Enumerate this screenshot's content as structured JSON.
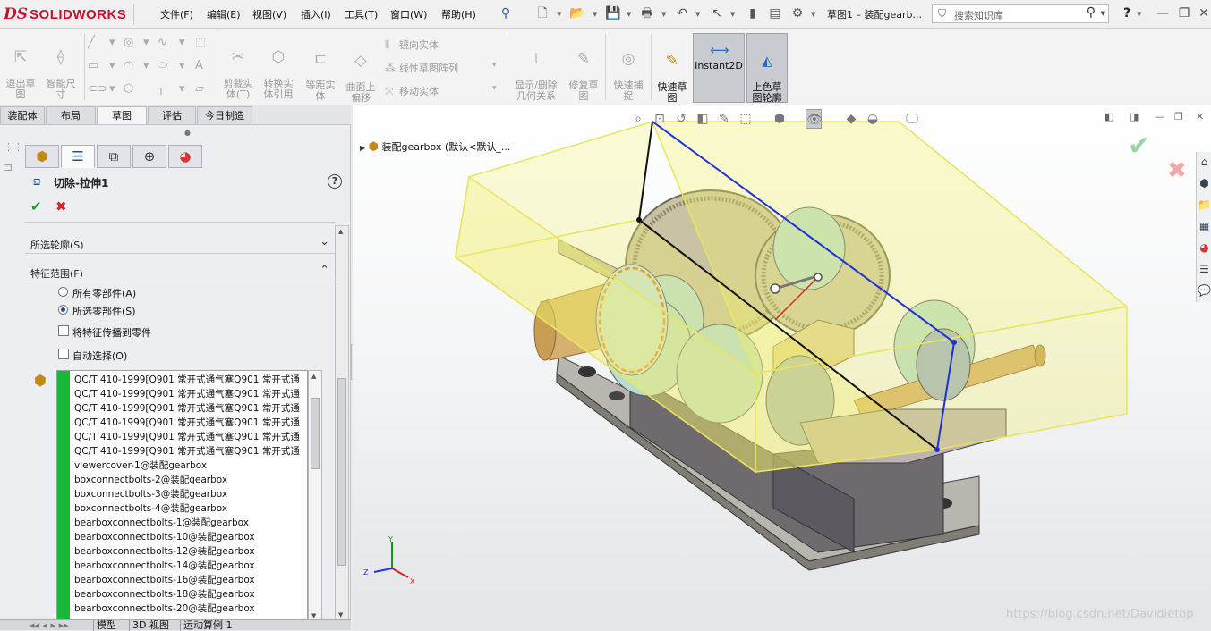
{
  "app": {
    "logo_ds": "DS",
    "logo_text": "SOLIDWORKS",
    "menus": [
      "文件(F)",
      "编辑(E)",
      "视图(V)",
      "插入(I)",
      "工具(T)",
      "窗口(W)",
      "帮助(H)"
    ],
    "document_title": "草图1 – 装配gearb...",
    "search_placeholder": "搜索知识库",
    "help_label": "?"
  },
  "ribbon": {
    "exit_sketch": "退出草\n图",
    "smart_dim": "智能尺\n寸",
    "trim": "剪裁实\n体(T)",
    "convert": "转换实\n体引用",
    "offset": "等距实\n体",
    "surface_offset": "曲面上\n偏移",
    "mirror": "镜向实体",
    "linear_pattern": "线性草图阵列",
    "move": "移动实体",
    "show_relations": "显示/删除\n几何关系",
    "repair": "修复草\n图",
    "quick_snap": "快速捕\n捉",
    "rapid_sketch": "快速草\n图",
    "instant2d": "Instant2D",
    "shaded_contours": "上色草\n图轮廓"
  },
  "tabs": [
    "装配体",
    "布局",
    "草图",
    "评估",
    "今日制造"
  ],
  "active_tab": "草图",
  "feature": {
    "title": "切除-拉伸1",
    "help": "?",
    "ok": "✔",
    "cancel": "✖"
  },
  "groups": {
    "selected_contours": "所选轮廓(S)",
    "feature_scope": "特征范围(F)"
  },
  "scope_options": {
    "all_components": "所有零部件(A)",
    "selected_components": "所选零部件(S)",
    "propagate": "将特征传播到零件",
    "auto_select": "自动选择(O)",
    "selected": "selected_components"
  },
  "components": [
    "QC/T 410-1999[Q901 常开式通气塞Q901 常开式通",
    "QC/T 410-1999[Q901 常开式通气塞Q901 常开式通",
    "QC/T 410-1999[Q901 常开式通气塞Q901 常开式通",
    "QC/T 410-1999[Q901 常开式通气塞Q901 常开式通",
    "QC/T 410-1999[Q901 常开式通气塞Q901 常开式通",
    "QC/T 410-1999[Q901 常开式通气塞Q901 常开式通",
    "viewercover-1@装配gearbox",
    "boxconnectbolts-2@装配gearbox",
    "boxconnectbolts-3@装配gearbox",
    "boxconnectbolts-4@装配gearbox",
    "bearboxconnectbolts-1@装配gearbox",
    "bearboxconnectbolts-10@装配gearbox",
    "bearboxconnectbolts-12@装配gearbox",
    "bearboxconnectbolts-14@装配gearbox",
    "bearboxconnectbolts-16@装配gearbox",
    "bearboxconnectbolts-18@装配gearbox",
    "bearboxconnectbolts-20@装配gearbox"
  ],
  "bottom_tabs": [
    "模型",
    "3D 视图",
    "运动算例 1"
  ],
  "viewport": {
    "tree_node": "装配gearbox (默认<默认_...",
    "watermark": "https://blog.csdn.net/Davidietop",
    "axes": {
      "x": "X",
      "y": "Y",
      "z": "Z"
    }
  },
  "colors": {
    "brand_red": "#c8102e",
    "selection_green": "#19b83a",
    "cut_volume_yellow": "#f2f06a",
    "ok_green": "#1a9c2c",
    "cancel_red": "#dd2222"
  }
}
